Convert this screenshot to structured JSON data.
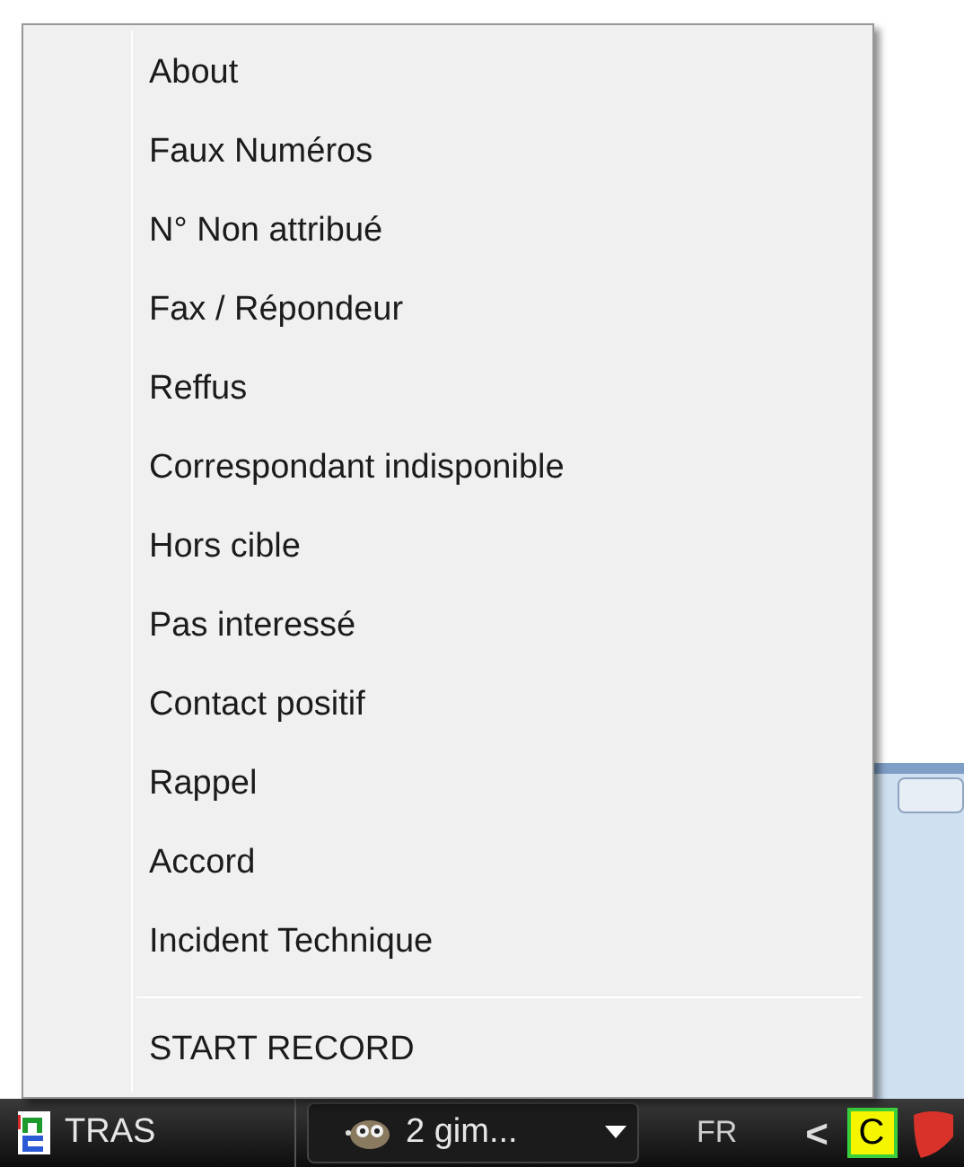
{
  "menu": {
    "items": [
      {
        "label": "About"
      },
      {
        "label": "Faux Numéros"
      },
      {
        "label": "N° Non attribué"
      },
      {
        "label": "Fax / Répondeur"
      },
      {
        "label": "Reffus"
      },
      {
        "label": "Correspondant indisponible"
      },
      {
        "label": "Hors cible"
      },
      {
        "label": "Pas interessé"
      },
      {
        "label": "Contact positif"
      },
      {
        "label": "Rappel"
      },
      {
        "label": "Accord"
      },
      {
        "label": "Incident Technique"
      }
    ],
    "footer_item": {
      "label": "START RECORD"
    }
  },
  "taskbar": {
    "app_button": {
      "label": "TRAS"
    },
    "group_button": {
      "label": "2 gim..."
    },
    "language": "FR",
    "tray_toggle": "<",
    "tray_icon_letter": "C"
  }
}
